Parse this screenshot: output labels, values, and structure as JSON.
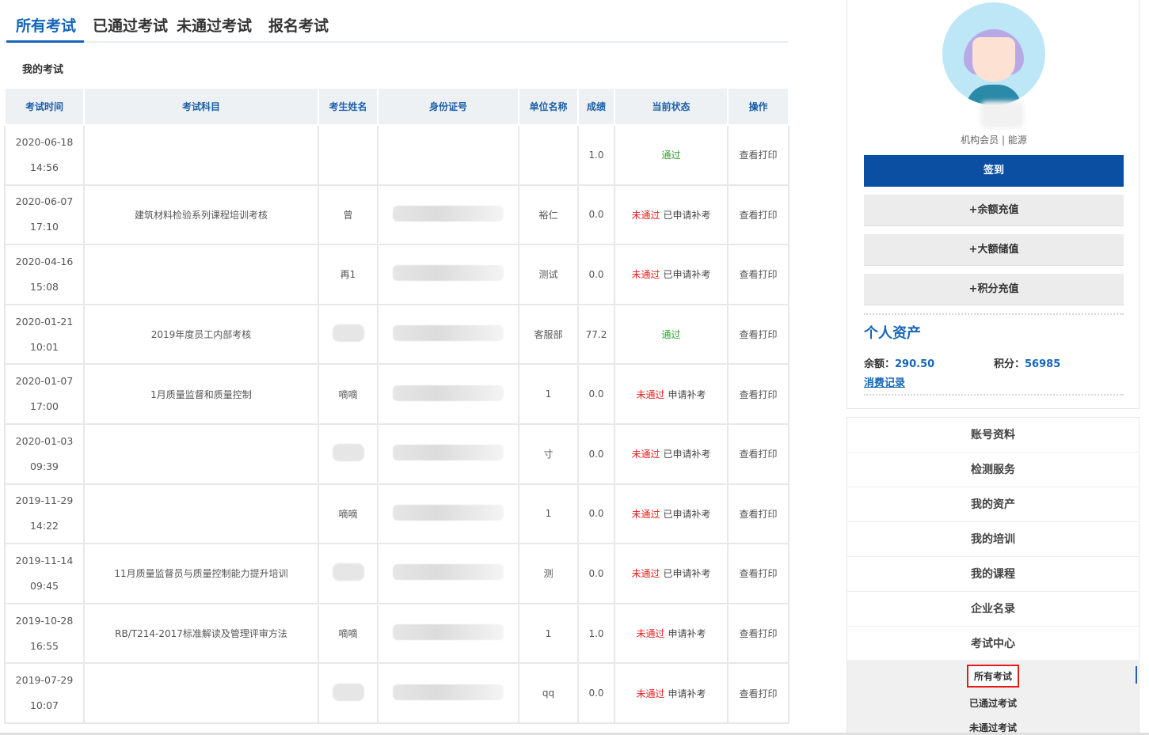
{
  "tabs": [
    {
      "label": "所有考试",
      "active": true
    },
    {
      "label": "已通过考试",
      "active": false
    },
    {
      "label": "未通过考试",
      "active": false
    },
    {
      "label": "报名考试",
      "active": false
    }
  ],
  "section_title": "我的考试",
  "table": {
    "headers": [
      "考试时间",
      "考试科目",
      "考生姓名",
      "身份证号",
      "单位名称",
      "成绩",
      "当前状态",
      "操作"
    ],
    "rows": [
      {
        "date": "2020-06-18",
        "time": "14:56",
        "subject": "",
        "name": "",
        "id_redacted": false,
        "unit": "",
        "score": "1.0",
        "status": "通过",
        "status_type": "pass",
        "status_suffix": "",
        "action": "查看打印"
      },
      {
        "date": "2020-06-07",
        "time": "17:10",
        "subject": "建筑材料检验系列课程培训考核",
        "name": "曾",
        "id_redacted": true,
        "unit": "裕仁",
        "score": "0.0",
        "status": "未通过",
        "status_type": "fail",
        "status_suffix": "已申请补考",
        "action": "查看打印"
      },
      {
        "date": "2020-04-16",
        "time": "15:08",
        "subject": "",
        "name": "再1",
        "id_redacted": true,
        "unit": "测试",
        "score": "0.0",
        "status": "未通过",
        "status_type": "fail",
        "status_suffix": "已申请补考",
        "action": "查看打印"
      },
      {
        "date": "2020-01-21",
        "time": "10:01",
        "subject": "2019年度员工内部考核",
        "name": "",
        "name_redacted": true,
        "id_redacted": true,
        "unit": "客服部",
        "score": "77.2",
        "status": "通过",
        "status_type": "pass",
        "status_suffix": "",
        "action": "查看打印"
      },
      {
        "date": "2020-01-07",
        "time": "17:00",
        "subject": "1月质量监督和质量控制",
        "name": "嘀嘀",
        "id_redacted": true,
        "unit": "1",
        "score": "0.0",
        "status": "未通过",
        "status_type": "fail",
        "status_suffix": "申请补考",
        "action": "查看打印"
      },
      {
        "date": "2020-01-03",
        "time": "09:39",
        "subject": "",
        "name": "",
        "name_redacted": true,
        "id_redacted": true,
        "unit": "寸",
        "score": "0.0",
        "status": "未通过",
        "status_type": "fail",
        "status_suffix": "已申请补考",
        "action": "查看打印"
      },
      {
        "date": "2019-11-29",
        "time": "14:22",
        "subject": "",
        "name": "嘀嘀",
        "id_redacted": true,
        "unit": "1",
        "score": "0.0",
        "status": "未通过",
        "status_type": "fail",
        "status_suffix": "已申请补考",
        "action": "查看打印"
      },
      {
        "date": "2019-11-14",
        "time": "09:45",
        "subject": "11月质量监督员与质量控制能力提升培训",
        "name": "",
        "name_redacted": true,
        "id_redacted": true,
        "unit": "测",
        "score": "0.0",
        "status": "未通过",
        "status_type": "fail",
        "status_suffix": "已申请补考",
        "action": "查看打印"
      },
      {
        "date": "2019-10-28",
        "time": "16:55",
        "subject": "RB/T214-2017标准解读及管理评审方法",
        "name": "嘀嘀",
        "id_redacted": true,
        "unit": "1",
        "score": "1.0",
        "status": "未通过",
        "status_type": "fail",
        "status_suffix": "申请补考",
        "action": "查看打印"
      },
      {
        "date": "2019-07-29",
        "time": "10:07",
        "subject": "",
        "name": "",
        "name_redacted": true,
        "id_redacted": true,
        "unit": "qq",
        "score": "0.0",
        "status": "未通过",
        "status_type": "fail",
        "status_suffix": "申请补考",
        "action": "查看打印"
      }
    ]
  },
  "sidebar": {
    "member_info": "机构会员 | 能源",
    "signin_label": "签到",
    "recharge_buttons": [
      "+余额充值",
      "+大额储值",
      "+积分充值"
    ],
    "assets_title": "个人资产",
    "balance_label": "余额：",
    "balance_value": "290.50",
    "points_label": "积分：",
    "points_value": "56985",
    "consume_link": "消费记录",
    "menu": [
      "账号资料",
      "检测服务",
      "我的资产",
      "我的培训",
      "我的课程",
      "企业名录",
      "考试中心"
    ],
    "submenu": [
      "所有考试",
      "已通过考试",
      "未通过考试"
    ]
  },
  "colors": {
    "accent": "#1666b8",
    "signin_button": "#0b4fa3",
    "pass": "#2fa12f",
    "fail": "#e82020",
    "highlight_border": "#e21c1c"
  }
}
